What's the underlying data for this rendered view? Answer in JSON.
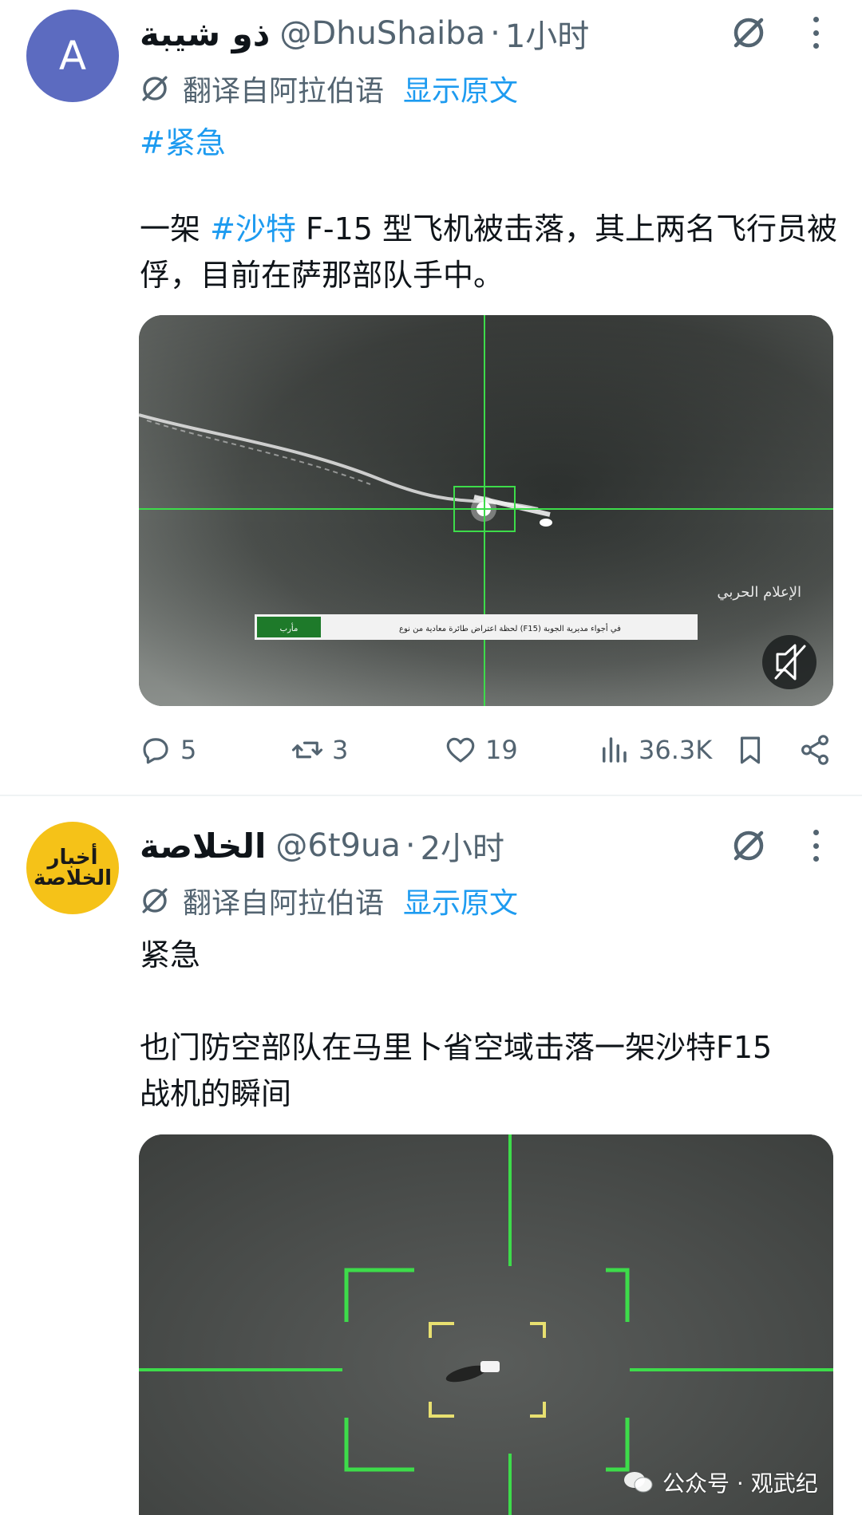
{
  "tweets": [
    {
      "avatar_letter": "A",
      "display_name": "ذو شيبة",
      "handle": "@DhuShaiba",
      "dot": "·",
      "time": "1小时",
      "translated_label": "翻译自阿拉伯语",
      "show_original": "显示原文",
      "hashtag_line": "#紧急",
      "body_prefix": "一架 ",
      "body_tag": "#沙特",
      "body_rest": " F-15 型飞机被击落，其上两名飞行员被俘，目前在萨那部队手中。",
      "media": {
        "channel_logo": "الإعلام الحربي",
        "ticker_text": "لحظة اعتراض طائرة معادية من نوع (F15) في أجواء مديرية الجوبة",
        "ticker_label": "مأرب"
      },
      "stats": {
        "replies": "5",
        "reposts": "3",
        "likes": "19",
        "views": "36.3K"
      }
    },
    {
      "avatar_line1": "أخبار",
      "avatar_line2": "الخلاصة",
      "display_name": "الخلاصة",
      "handle": "@6t9ua",
      "dot": "·",
      "time": "2小时",
      "translated_label": "翻译自阿拉伯语",
      "show_original": "显示原文",
      "line1": "紧急",
      "body": "也门防空部队在马里卜省空域击落一架沙特F15战机的瞬间"
    }
  ],
  "watermark": "公众号 · 观武纪",
  "colors": {
    "link": "#1d9bf0",
    "muted": "#536471",
    "hud_green": "#3ddc4a",
    "hud_yellow": "#e8e070"
  }
}
